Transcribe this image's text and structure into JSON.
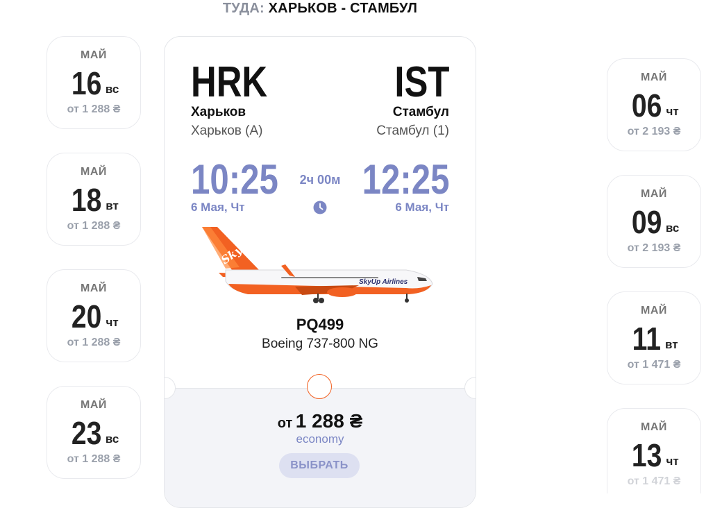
{
  "header": {
    "direction_label": "ТУДА:",
    "route": "ХАРЬКОВ - СТАМБУЛ"
  },
  "left_dates": [
    {
      "month": "МАЙ",
      "day": "16",
      "weekday": "вс",
      "price": "от 1 288 ₴"
    },
    {
      "month": "МАЙ",
      "day": "18",
      "weekday": "вт",
      "price": "от 1 288 ₴"
    },
    {
      "month": "МАЙ",
      "day": "20",
      "weekday": "чт",
      "price": "от 1 288 ₴"
    },
    {
      "month": "МАЙ",
      "day": "23",
      "weekday": "вс",
      "price": "от 1 288 ₴"
    }
  ],
  "right_dates": [
    {
      "month": "МАЙ",
      "day": "06",
      "weekday": "чт",
      "price": "от 2 193 ₴"
    },
    {
      "month": "МАЙ",
      "day": "09",
      "weekday": "вс",
      "price": "от 2 193 ₴"
    },
    {
      "month": "МАЙ",
      "day": "11",
      "weekday": "вт",
      "price": "от 1 471 ₴"
    },
    {
      "month": "МАЙ",
      "day": "13",
      "weekday": "чт",
      "price": "от 1 471 ₴"
    }
  ],
  "flight": {
    "origin": {
      "code": "HRK",
      "city": "Харьков",
      "airport": "Харьков (A)",
      "time": "10:25",
      "date": "6 Мая, Чт"
    },
    "destination": {
      "code": "IST",
      "city": "Стамбул",
      "airport": "Стамбул (1)",
      "time": "12:25",
      "date": "6 Мая, Чт"
    },
    "duration": "2ч 00м",
    "airline_livery_text": "SkyUp",
    "airline_name": "SkyUp Airlines",
    "flight_number": "PQ499",
    "aircraft": "Boeing 737-800 NG",
    "price_prefix": "от",
    "price_amount": "1 288 ₴",
    "fare_class": "economy",
    "select_label": "ВЫБРАТЬ"
  },
  "colors": {
    "accent": "#7b86c4",
    "brand_orange": "#f26122",
    "muted": "#9aa0ab",
    "button_bg": "#dde0f1"
  },
  "icons": {
    "duration": "clock-icon",
    "aircraft": "airplane-image"
  }
}
